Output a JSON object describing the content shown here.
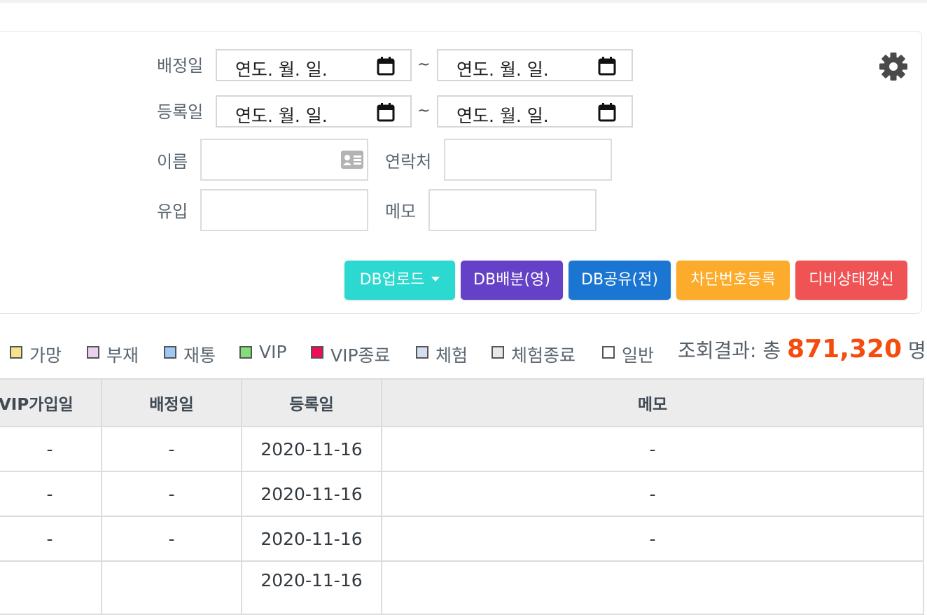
{
  "filters": {
    "assign_label": "배정일",
    "register_label": "등록일",
    "date_placeholder": "연도. 월. 일.",
    "tilde": "~",
    "name_label": "이름",
    "contact_label": "연락처",
    "source_label": "유입",
    "memo_label": "메모"
  },
  "buttons": {
    "db_upload": "DB업로드",
    "db_distribute": "DB배분(영)",
    "db_share": "DB공유(전)",
    "block_number": "차단번호등록",
    "db_status_update": "디비상태갱신"
  },
  "colors": {
    "db_upload": "#2bd9d0",
    "db_distribute": "#6541c8",
    "db_share": "#1b76d3",
    "block_number": "#fcab2b",
    "db_status_update": "#ef5354",
    "result_number": "#f44c0e"
  },
  "legend": [
    {
      "label": "가망",
      "color": "#f3e48c"
    },
    {
      "label": "부재",
      "color": "#ead2ee"
    },
    {
      "label": "재통",
      "color": "#9fc8f5"
    },
    {
      "label": "VIP",
      "color": "#82de78"
    },
    {
      "label": "VIP종료",
      "color": "#f00a5c"
    },
    {
      "label": "체험",
      "color": "#d3dff1"
    },
    {
      "label": "체험종료",
      "color": "#e8e8e8"
    },
    {
      "label": "일반",
      "color": "#ffffff"
    }
  ],
  "result": {
    "prefix": "조회결과: 총",
    "count": "871,320",
    "suffix": "명"
  },
  "table": {
    "headers": [
      "VIP가입일",
      "배정일",
      "등록일",
      "메모"
    ],
    "rows": [
      [
        "-",
        "-",
        "2020-11-16",
        "-"
      ],
      [
        "-",
        "-",
        "2020-11-16",
        "-"
      ],
      [
        "-",
        "-",
        "2020-11-16",
        "-"
      ],
      [
        "",
        "",
        "2020-11-16",
        ""
      ]
    ]
  },
  "icons": {
    "calendar": "calendar-icon",
    "contact_card": "contact-card-icon",
    "settings": "gear-icon"
  }
}
